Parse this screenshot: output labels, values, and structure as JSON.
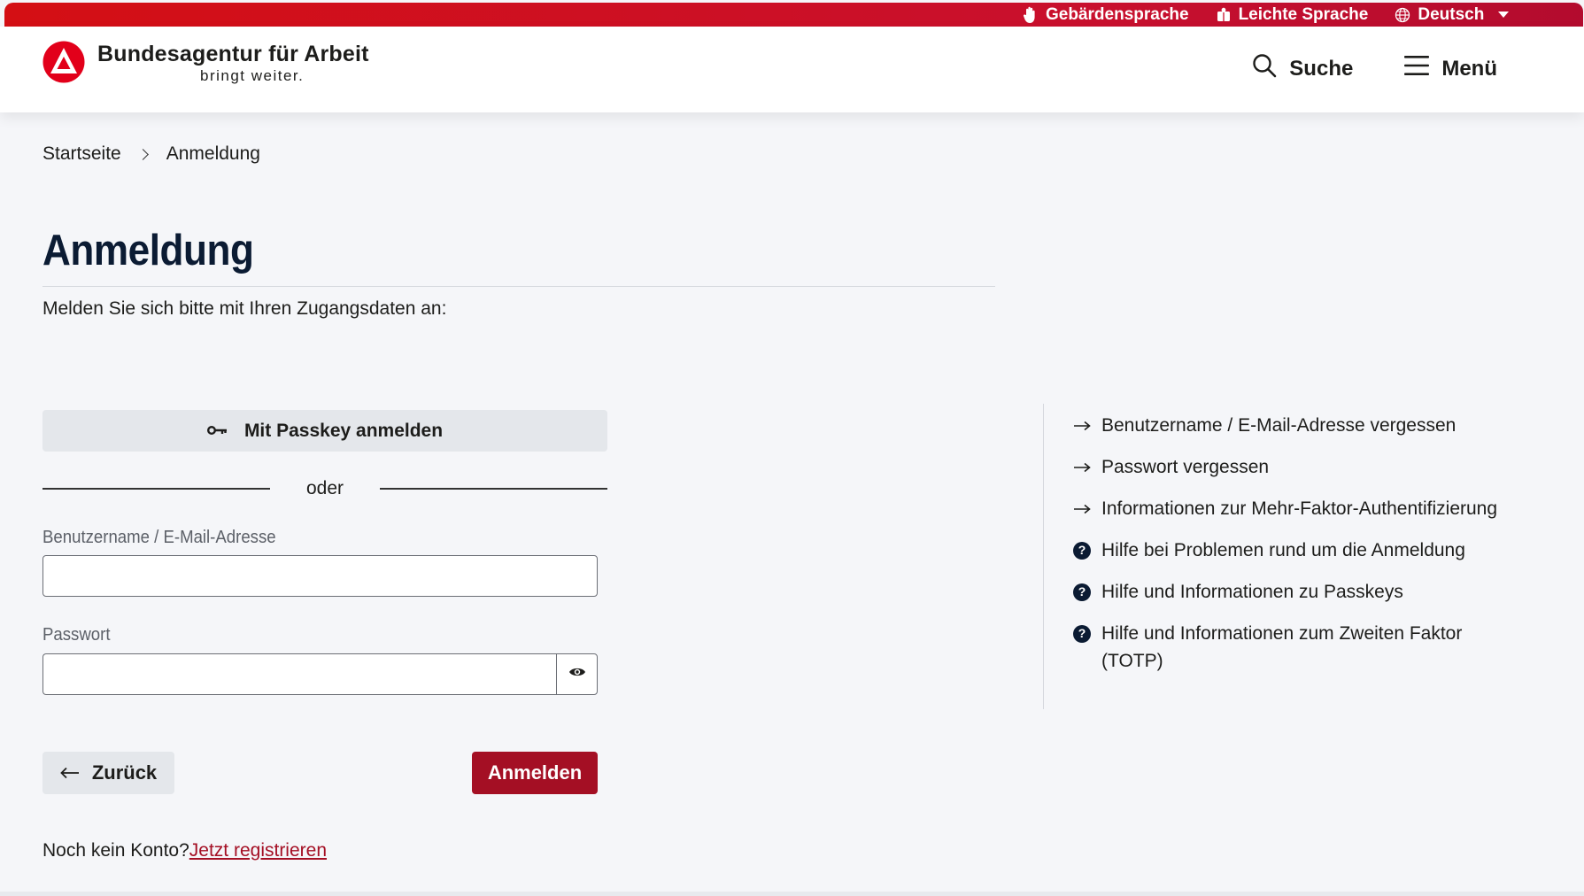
{
  "colors": {
    "brand_red": "#c8102e",
    "button_red": "#a40f24",
    "title_navy": "#0b1b33",
    "page_bg": "#f5f6f9"
  },
  "topbar": {
    "sign_language": {
      "label": "Gebärdensprache",
      "icon": "hand-icon"
    },
    "easy_language": {
      "label": "Leichte Sprache",
      "icon": "easy-language-book-icon"
    },
    "language": {
      "label": "Deutsch",
      "icon": "globe-icon"
    }
  },
  "header": {
    "logo_name": "Bundesagentur für Arbeit",
    "logo_slogan": "bringt weiter.",
    "search_label": "Suche",
    "menu_label": "Menü"
  },
  "breadcrumb": {
    "items": [
      "Startseite",
      "Anmeldung"
    ]
  },
  "main": {
    "title": "Anmeldung",
    "intro": "Melden Sie sich bitte mit Ihren Zugangsdaten an:",
    "passkey_button": "Mit Passkey anmelden",
    "or_text": "oder",
    "username_label": "Benutzername / E-Mail-Adresse",
    "username_value": "",
    "password_label": "Passwort",
    "password_value": "",
    "back_button": "Zurück",
    "login_button": "Anmelden",
    "register_prompt": "Noch kein Konto?",
    "register_link": "Jetzt registrieren"
  },
  "help": {
    "items": [
      {
        "label": "Benutzername / E-Mail-Adresse vergessen",
        "icon": "arrow-right-icon"
      },
      {
        "label": "Passwort vergessen",
        "icon": "arrow-right-icon"
      },
      {
        "label": "Informationen zur Mehr-Faktor-Authentifizierung",
        "icon": "arrow-right-icon"
      },
      {
        "label": "Hilfe bei Problemen rund um die Anmeldung",
        "icon": "help-circle-icon"
      },
      {
        "label": "Hilfe und Informationen zu Passkeys",
        "icon": "help-circle-icon"
      },
      {
        "label": "Hilfe und Informationen zum Zweiten Faktor (TOTP)",
        "icon": "help-circle-icon"
      }
    ]
  }
}
